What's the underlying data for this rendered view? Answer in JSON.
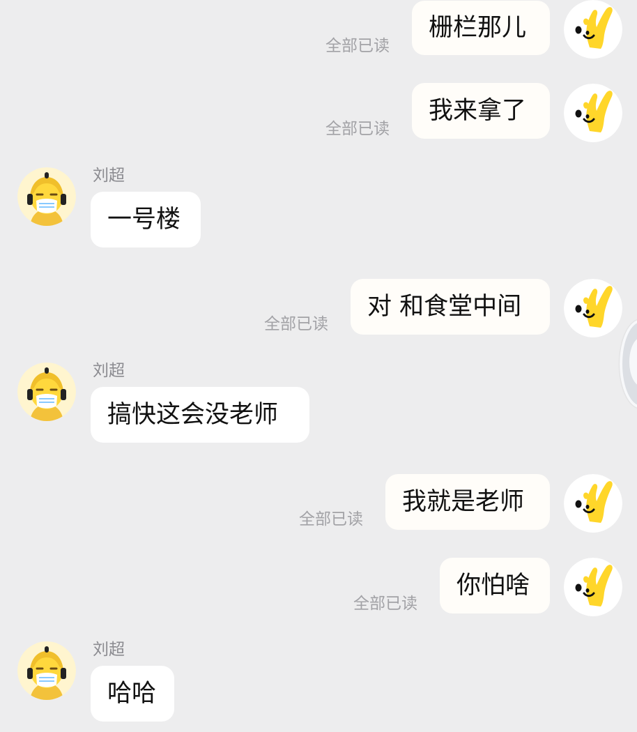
{
  "other_user": {
    "name": "刘超",
    "avatar_icon": "masked-person-avatar-icon"
  },
  "self_user": {
    "avatar_icon": "yellow-finger-character-avatar-icon"
  },
  "messages": [
    {
      "from": "self",
      "text": "栅栏那儿",
      "status": "全部已读"
    },
    {
      "from": "self",
      "text": "我来拿了",
      "status": "全部已读"
    },
    {
      "from": "other",
      "sender": "刘超",
      "text": "一号楼"
    },
    {
      "from": "self",
      "text": "对 和食堂中间",
      "status": "全部已读"
    },
    {
      "from": "other",
      "sender": "刘超",
      "text": "搞快这会没老师"
    },
    {
      "from": "self",
      "text": "我就是老师",
      "status": "全部已读"
    },
    {
      "from": "self",
      "text": "你怕啥",
      "status": "全部已读"
    },
    {
      "from": "other",
      "sender": "刘超",
      "text": "哈哈"
    }
  ],
  "colors": {
    "background": "#ededee",
    "bubble": "#ffffff",
    "read_status": "#a2a2a6",
    "avatar_yellow": "#ffd62a"
  }
}
